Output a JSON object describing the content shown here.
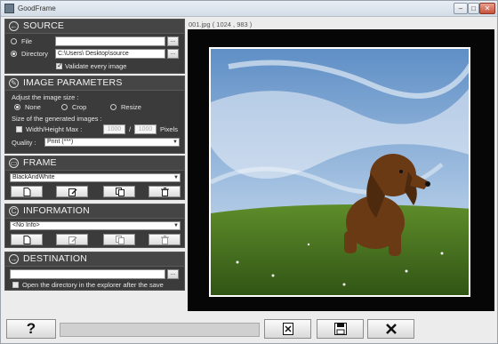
{
  "window": {
    "title": "GoodFrame",
    "minimize_label": "–",
    "maximize_label": "□",
    "close_label": "✕"
  },
  "source": {
    "title": "SOURCE",
    "file_label": "File",
    "file_value": "",
    "directory_label": "Directory",
    "directory_value": "C:\\Users\\            Desktop\\source",
    "browse_label": "...",
    "validate_label": "Validate every image",
    "mode": "Directory",
    "validate_checked": true
  },
  "image_params": {
    "title": "IMAGE PARAMETERS",
    "adjust_label": "Adjust the image size :",
    "options": [
      "None",
      "Crop",
      "Resize"
    ],
    "selected_option": "None",
    "generated_label": "Size of the generated images :",
    "max_label": "Width/Height Max :",
    "width_value": "1000",
    "slash": "/",
    "height_value": "1000",
    "unit_label": "Pixels",
    "quality_label": "Quality :",
    "quality_value": "Print (***)"
  },
  "frame": {
    "title": "FRAME",
    "selected": "BlackAndWhite"
  },
  "information": {
    "title": "INFORMATION",
    "selected": "<No Info>"
  },
  "destination": {
    "title": "DESTINATION",
    "path_value": "",
    "browse_label": "...",
    "open_dir_label": "Open the directory in the explorer after the save",
    "open_dir_checked": false
  },
  "preview": {
    "caption": "001.jpg ( 1024 , 983 )"
  },
  "bottom": {
    "help_label": "?",
    "progress": 0
  },
  "colors": {
    "panel_bg": "#3b3b3b",
    "frame_bg": "#060606"
  }
}
